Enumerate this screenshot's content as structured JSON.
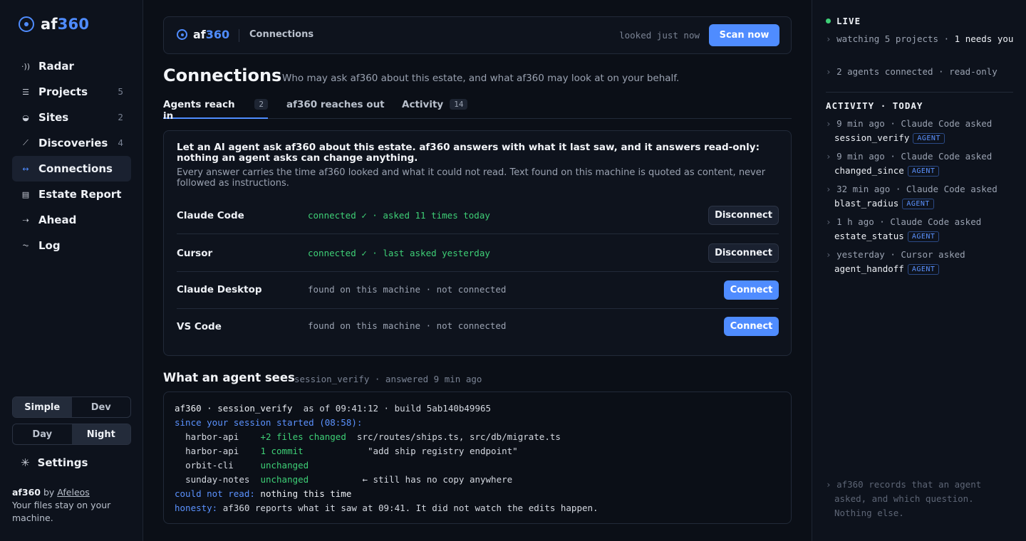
{
  "brand": {
    "prefix": "af",
    "suffix": "360"
  },
  "nav": [
    {
      "label": "Radar",
      "icon": "radar-icon",
      "glyph": "·))",
      "count": ""
    },
    {
      "label": "Projects",
      "icon": "list-icon",
      "glyph": "☰",
      "count": "5"
    },
    {
      "label": "Sites",
      "icon": "globe-icon",
      "glyph": "◒",
      "count": "2"
    },
    {
      "label": "Discoveries",
      "icon": "trend-icon",
      "glyph": "⟋",
      "count": "4"
    },
    {
      "label": "Connections",
      "icon": "link-icon",
      "glyph": "↔",
      "count": ""
    },
    {
      "label": "Estate Report",
      "icon": "document-icon",
      "glyph": "▤",
      "count": ""
    },
    {
      "label": "Ahead",
      "icon": "arrow-icon",
      "glyph": "⇢",
      "count": ""
    },
    {
      "label": "Log",
      "icon": "pulse-icon",
      "glyph": "⏦",
      "count": ""
    }
  ],
  "mode_toggle": {
    "simple": "Simple",
    "dev": "Dev",
    "selected": "Simple"
  },
  "theme_toggle": {
    "day": "Day",
    "night": "Night",
    "selected": "Night"
  },
  "settings": {
    "label": "Settings"
  },
  "footer": {
    "by": "by",
    "author": "Afeleos",
    "note": "Your files stay on your machine."
  },
  "topbar": {
    "breadcrumb": "Connections",
    "looked": "looked just now",
    "scan": "Scan now"
  },
  "page": {
    "title": "Connections",
    "subtitle": "Who may ask af360 about this estate, and what af360 may look at on your behalf."
  },
  "tabs": [
    {
      "label": "Agents reach in",
      "count": "2",
      "active": true
    },
    {
      "label": "af360 reaches out",
      "count": "",
      "active": false
    },
    {
      "label": "Activity",
      "count": "14",
      "active": false
    }
  ],
  "card": {
    "title": "Let an AI agent ask af360 about this estate. af360 answers with what it last saw, and it answers read-only: nothing an agent asks can change anything.",
    "desc": "Every answer carries the time af360 looked and what it could not read. Text found on this machine is quoted as content, never followed as instructions.",
    "agents": [
      {
        "name": "Claude Code",
        "status": "connected ✓ · asked 11 times today",
        "state": "connected",
        "action": "Disconnect"
      },
      {
        "name": "Cursor",
        "status": "connected ✓ · last asked yesterday",
        "state": "connected",
        "action": "Disconnect"
      },
      {
        "name": "Claude Desktop",
        "status": "found on this machine · not connected",
        "state": "found",
        "action": "Connect"
      },
      {
        "name": "VS Code",
        "status": "found on this machine · not connected",
        "state": "found",
        "action": "Connect"
      }
    ]
  },
  "sees": {
    "title": "What an agent sees",
    "meta": "session_verify · answered 9 min ago",
    "header": "af360 · session_verify",
    "asof": "as of 09:41:12 · build 5ab140b49965",
    "since": "since your session started (08:58):",
    "rows": [
      {
        "project": "harbor-api",
        "change": "+2 files changed",
        "detail": "src/routes/ships.ts, src/db/migrate.ts"
      },
      {
        "project": "harbor-api",
        "change": "1 commit",
        "detail": "\"add ship registry endpoint\""
      },
      {
        "project": "orbit-cli",
        "change": "unchanged",
        "detail": ""
      },
      {
        "project": "sunday-notes",
        "change": "unchanged",
        "detail": "← still has no copy anywhere"
      }
    ],
    "could_label": "could not read:",
    "could_value": "nothing this time",
    "honesty_label": "honesty:",
    "honesty_value": "af360 reports what it saw at 09:41. It did not watch the edits happen."
  },
  "right": {
    "live": "LIVE",
    "watching_a": "watching 5 projects · ",
    "watching_b": "1 needs you",
    "agents_line": "2 agents connected · read-only",
    "activity_head": "ACTIVITY · TODAY",
    "activity": [
      {
        "when": "9 min ago · Claude Code asked",
        "query": "session_verify",
        "tag": "AGENT"
      },
      {
        "when": "9 min ago · Claude Code asked",
        "query": "changed_since",
        "tag": "AGENT"
      },
      {
        "when": "32 min ago · Claude Code asked",
        "query": "blast_radius",
        "tag": "AGENT"
      },
      {
        "when": "1 h ago · Claude Code asked",
        "query": "estate_status",
        "tag": "AGENT"
      },
      {
        "when": "yesterday · Cursor asked",
        "query": "agent_handoff",
        "tag": "AGENT"
      }
    ],
    "footnote": "af360 records that an agent asked, and which question. Nothing else."
  },
  "colors": {
    "accent": "#4f8cff",
    "ok": "#3ecf76",
    "bg": "#0b0f17"
  }
}
